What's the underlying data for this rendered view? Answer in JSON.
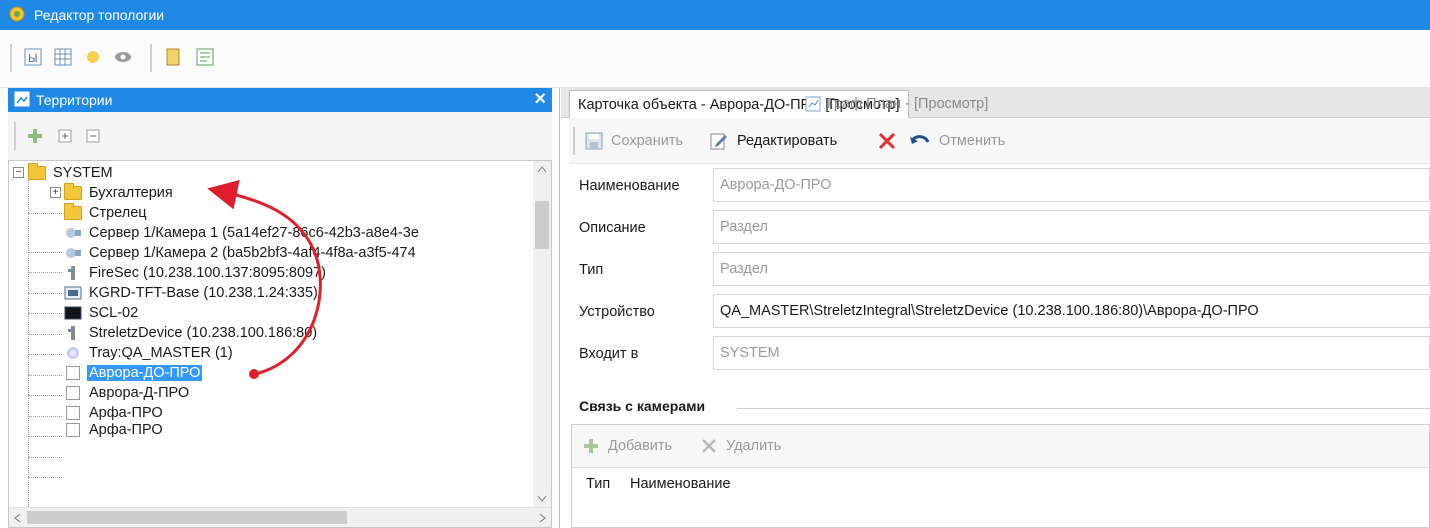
{
  "window": {
    "title": "Редактор топологии"
  },
  "toolbar": {
    "icons": [
      "zoom-icon",
      "grid-icon",
      "star-icon",
      "eye-icon",
      "page-icon",
      "layout-icon"
    ]
  },
  "left_panel": {
    "title": "Территории",
    "close_glyph": "×",
    "tree": [
      {
        "label": "SYSTEM",
        "icon": "folder-icon"
      },
      {
        "label": "Бухгалтерия",
        "icon": "folder-icon"
      },
      {
        "label": "Стрелец",
        "icon": "folder-icon"
      },
      {
        "label": "Сервер 1/Камера 1 (5a14ef27-86c6-42b3-a8e4-3e",
        "icon": "camera-icon"
      },
      {
        "label": "Сервер 1/Камера 2 (ba5b2bf3-4af4-4f8a-a3f5-474",
        "icon": "camera-icon"
      },
      {
        "label": "FireSec (10.238.100.137:8095:8097)",
        "icon": "device-icon"
      },
      {
        "label": "KGRD-TFT-Base (10.238.1.24:335)",
        "icon": "terminal-icon"
      },
      {
        "label": "SCL-02",
        "icon": "monitor-icon"
      },
      {
        "label": "StreletzDevice (10.238.100.186:80)",
        "icon": "device-icon"
      },
      {
        "label": "Tray:QA_MASTER (1)",
        "icon": "tray-icon"
      },
      {
        "label": "Аврора-ДО-ПРО",
        "icon": "checkbox-icon",
        "selected": true
      },
      {
        "label": "Аврора-Д-ПРО",
        "icon": "checkbox-icon"
      },
      {
        "label": "Арфа-ПРО",
        "icon": "checkbox-icon"
      },
      {
        "label": "Арфа-ПРО",
        "icon": "checkbox-icon"
      }
    ]
  },
  "right_panel": {
    "tabs": [
      {
        "label": "Карточка объекта - Аврора-ДО-ПРО [Просмотр]",
        "active": true
      },
      {
        "label": "Граф План - [Просмотр]",
        "active": false
      }
    ],
    "toolbar": {
      "save_label": "Сохранить",
      "edit_label": "Редактировать",
      "cancel_label": "Отменить"
    },
    "form": {
      "name_label": "Наименование",
      "name_value": "Аврора-ДО-ПРО",
      "description_label": "Описание",
      "description_value": "Раздел",
      "type_label": "Тип",
      "type_value": "Раздел",
      "device_label": "Устройство",
      "device_value": "QA_MASTER\\StreletzIntegral\\StreletzDevice (10.238.100.186:80)\\Аврора-ДО-ПРО",
      "parent_label": "Входит в",
      "parent_value": "SYSTEM"
    },
    "cameras": {
      "section_title": "Связь с камерами",
      "add_label": "Добавить",
      "delete_label": "Удалить",
      "columns": [
        "Тип",
        "Наименование"
      ]
    }
  },
  "colors": {
    "accent": "#1e8ae6",
    "selection": "#3399ff",
    "arrow": "#e01f2c",
    "delete_x": "#e0322d"
  }
}
